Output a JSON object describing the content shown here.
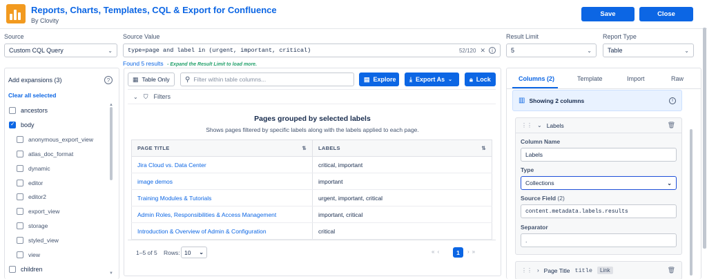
{
  "header": {
    "title": "Reports, Charts, Templates, CQL & Export for Confluence",
    "subtitle": "By Clovity",
    "save_label": "Save",
    "close_label": "Close"
  },
  "form": {
    "source_label": "Source",
    "source_value": "Custom CQL Query",
    "source_value_label": "Source Value",
    "cql_value": "type=page and label in (urgent, important, critical)",
    "char_count": "52/120",
    "result_limit_label": "Result Limit",
    "result_limit_value": "5",
    "report_type_label": "Report Type",
    "report_type_value": "Table",
    "found_text": "Found 5 results",
    "expand_hint": "- Expand the Result Limit to load more."
  },
  "expansions": {
    "title": "Add expansions (3)",
    "clear_label": "Clear all selected",
    "items": [
      {
        "label": "ancestors",
        "checked": false,
        "child": false
      },
      {
        "label": "body",
        "checked": true,
        "child": false
      },
      {
        "label": "anonymous_export_view",
        "checked": false,
        "child": true
      },
      {
        "label": "atlas_doc_format",
        "checked": false,
        "child": true
      },
      {
        "label": "dynamic",
        "checked": false,
        "child": true
      },
      {
        "label": "editor",
        "checked": false,
        "child": true
      },
      {
        "label": "editor2",
        "checked": false,
        "child": true
      },
      {
        "label": "export_view",
        "checked": false,
        "child": true
      },
      {
        "label": "storage",
        "checked": false,
        "child": true
      },
      {
        "label": "styled_view",
        "checked": false,
        "child": true
      },
      {
        "label": "view",
        "checked": false,
        "child": true
      },
      {
        "label": "children",
        "checked": false,
        "child": false
      }
    ]
  },
  "toolbar": {
    "table_only": "Table Only",
    "filter_placeholder": "Filter within table columns...",
    "explore": "Explore",
    "export_as": "Export As",
    "lock": "Lock",
    "filters": "Filters"
  },
  "report": {
    "title": "Pages grouped by selected labels",
    "subtitle": "Shows pages filtered by specific labels along with the labels applied to each page.",
    "columns": [
      "PAGE TITLE",
      "LABELS"
    ],
    "rows": [
      {
        "title": "Jira Cloud vs. Data Center",
        "labels": "critical, important"
      },
      {
        "title": "image demos",
        "labels": "important"
      },
      {
        "title": "Training Modules & Tutorials",
        "labels": "urgent, important, critical"
      },
      {
        "title": "Admin Roles, Responsibilities & Access Management",
        "labels": "important, critical"
      },
      {
        "title": "Introduction & Overview of Admin & Configuration",
        "labels": "critical"
      }
    ],
    "range": "1–5 of 5",
    "rows_label": "Rows:",
    "rows_value": "10",
    "page": "1"
  },
  "right": {
    "tabs": [
      "Columns (2)",
      "Template",
      "Import",
      "Raw"
    ],
    "showing": "Showing 2 columns",
    "column1_name": "Labels",
    "column_name_label": "Column Name",
    "column_name_value": "Labels",
    "type_label": "Type",
    "type_value": "Collections",
    "source_field_label": "Source Field",
    "source_field_count": "(2)",
    "source_field_value": "content.metadata.labels.results",
    "separator_label": "Separator",
    "separator_value": ".",
    "column2_name": "Page Title",
    "column2_key": "title",
    "column2_badge": "Link"
  },
  "colors": {
    "accent": "#0c66e4",
    "logo": "#f29a1f"
  }
}
